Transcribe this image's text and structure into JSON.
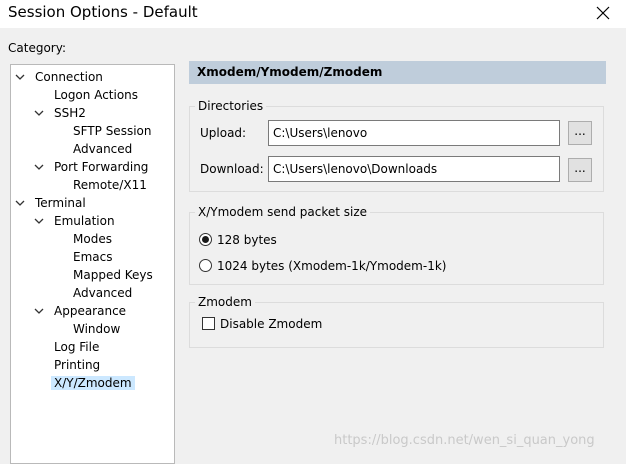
{
  "window": {
    "title": "Session Options - Default"
  },
  "category_label": "Category:",
  "tree": [
    {
      "label": "Connection",
      "expanded": true
    },
    {
      "label": "Logon Actions"
    },
    {
      "label": "SSH2",
      "expanded": true
    },
    {
      "label": "SFTP Session"
    },
    {
      "label": "Advanced"
    },
    {
      "label": "Port Forwarding",
      "expanded": true
    },
    {
      "label": "Remote/X11"
    },
    {
      "label": "Terminal",
      "expanded": true
    },
    {
      "label": "Emulation",
      "expanded": true
    },
    {
      "label": "Modes"
    },
    {
      "label": "Emacs"
    },
    {
      "label": "Mapped Keys"
    },
    {
      "label": "Advanced"
    },
    {
      "label": "Appearance",
      "expanded": true
    },
    {
      "label": "Window"
    },
    {
      "label": "Log File"
    },
    {
      "label": "Printing"
    },
    {
      "label": "X/Y/Zmodem",
      "selected": true
    }
  ],
  "panel": {
    "header": "Xmodem/Ymodem/Zmodem",
    "directories": {
      "title": "Directories",
      "upload_label": "Upload:",
      "upload_value": "C:\\Users\\lenovo",
      "download_label": "Download:",
      "download_value": "C:\\Users\\lenovo\\Downloads",
      "browse_label": "..."
    },
    "packet_size": {
      "title": "X/Ymodem send packet size",
      "option_128": "128 bytes",
      "option_1024": "1024 bytes  (Xmodem-1k/Ymodem-1k)",
      "selected": "128 bytes"
    },
    "zmodem": {
      "title": "Zmodem",
      "disable_label": "Disable Zmodem",
      "disable_checked": false
    }
  },
  "watermark": "https://blog.csdn.net/wen_si_quan_yong"
}
